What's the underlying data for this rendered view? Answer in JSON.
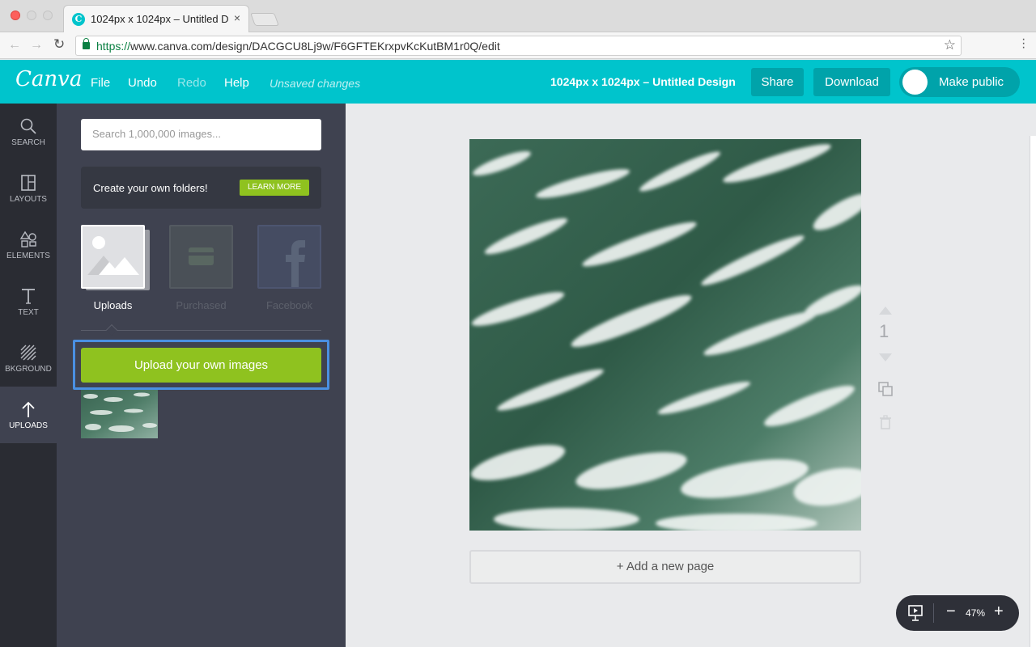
{
  "browser": {
    "tab_title": "1024px x 1024px – Untitled D",
    "tab_close": "×",
    "url_scheme": "https://",
    "url_rest": "www.canva.com/design/DACGCU8Lj9w/F6GFTEKrxpvKcKutBM1r0Q/edit"
  },
  "header": {
    "logo": "Canva",
    "menu": [
      "File",
      "Undo",
      "Redo",
      "Help"
    ],
    "unsaved": "Unsaved changes",
    "doc_title": "1024px x 1024px – Untitled Design",
    "share_label": "Share",
    "download_label": "Download",
    "make_public_label": "Make public",
    "brand_color": "#00c4cc"
  },
  "rail": {
    "items": [
      {
        "label": "SEARCH",
        "icon": "search-icon"
      },
      {
        "label": "LAYOUTS",
        "icon": "layouts-icon"
      },
      {
        "label": "ELEMENTS",
        "icon": "shapes-icon"
      },
      {
        "label": "TEXT",
        "icon": "text-icon"
      },
      {
        "label": "BKGROUND",
        "icon": "background-icon"
      },
      {
        "label": "UPLOADS",
        "icon": "upload-arrow-icon",
        "active": true
      }
    ]
  },
  "panel": {
    "search_placeholder": "Search 1,000,000 images...",
    "promo_text": "Create your own folders!",
    "promo_button": "LEARN MORE",
    "categories": [
      {
        "label": "Uploads",
        "active": true
      },
      {
        "label": "Purchased",
        "active": false
      },
      {
        "label": "Facebook",
        "active": false
      }
    ],
    "upload_button": "Upload your own images",
    "accent_green": "#8fc21f"
  },
  "canvas": {
    "page_number": "1",
    "add_page_label": "+ Add a new page"
  },
  "zoom": {
    "minus": "−",
    "value": "47%",
    "plus": "+"
  }
}
